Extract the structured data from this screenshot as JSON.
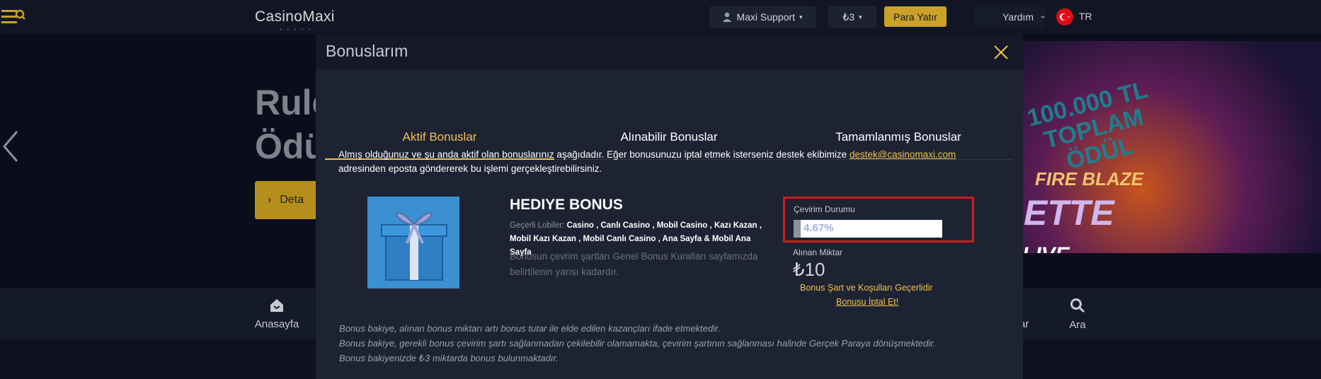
{
  "topbar": {
    "logo": "CasinoMaxi",
    "support_label": "Maxi Support",
    "balance_label": "₺3",
    "pay_button": "Para Yatır",
    "help_label": "Yardım",
    "language": "TR"
  },
  "hero": {
    "title_line1": "Rule",
    "title_line2": "Ödü",
    "button_label": "Deta",
    "promo_line1": "100.000 TL",
    "promo_line2": "TOPLAM",
    "promo_line3": "ÖDÜL",
    "promo_game1": "FIRE BLAZE",
    "promo_game2": "ETTE",
    "promo_game3": "LIVE"
  },
  "bottom_nav": {
    "home": "Anasayfa",
    "item_partial": "lar",
    "search": "Ara"
  },
  "modal": {
    "title": "Bonuslarım",
    "tabs": [
      "Aktif Bonuslar",
      "Alınabilir Bonuslar",
      "Tamamlanmış Bonuslar"
    ],
    "description": "Almış olduğunuz ve şu anda aktif olan bonuslarınız aşağıdadır. Eğer bonusunuzu iptal etmek isterseniz destek ekibimize",
    "email": "destek@casinomaxi.com",
    "description_end": "adresinden eposta göndererek bu işlemi gerçekleştirebilirsiniz.",
    "bonus": {
      "name": "HEDIYE BONUS",
      "lobbies_label": "Geçerli Lobiler:",
      "lobbies": "Casino , Canlı Casino , Mobil Casino , Kazı Kazan , Mobil Kazı Kazan , Mobil Canlı Casino , Ana Sayfa & Mobil Ana Sayfa",
      "rule_text": "Bonusun çevrim şartları Genel Bonus Kuralları sayfamızda belirtilenin yarısı kadardır.",
      "status_label": "Çevirim Durumu",
      "progress_text": "4.67%",
      "progress_value": 4.67,
      "amount_label": "Alınan Miktar",
      "amount": "₺10",
      "terms_label": "Bonus Şart ve Koşulları Geçerlidir",
      "cancel_label": "Bonusu İptal Et!"
    },
    "notes": [
      "Bonus bakiye, alınan bonus miktarı artı bonus tutar ile elde edilen kazançları ifade etmektedir.",
      "Bonus bakiye, gerekli bonus çevirim şartı sağlanmadan çekilebilir olamamakta, çevirim şartının sağlanması halinde Gerçek Paraya dönüşmektedir.",
      "Bonus bakiyenizde ₺3 miktarda bonus bulunmaktadır."
    ]
  },
  "colors": {
    "accent": "#f0c24a",
    "highlight_border": "#d11a1a",
    "modal_bg": "#1e2333"
  }
}
